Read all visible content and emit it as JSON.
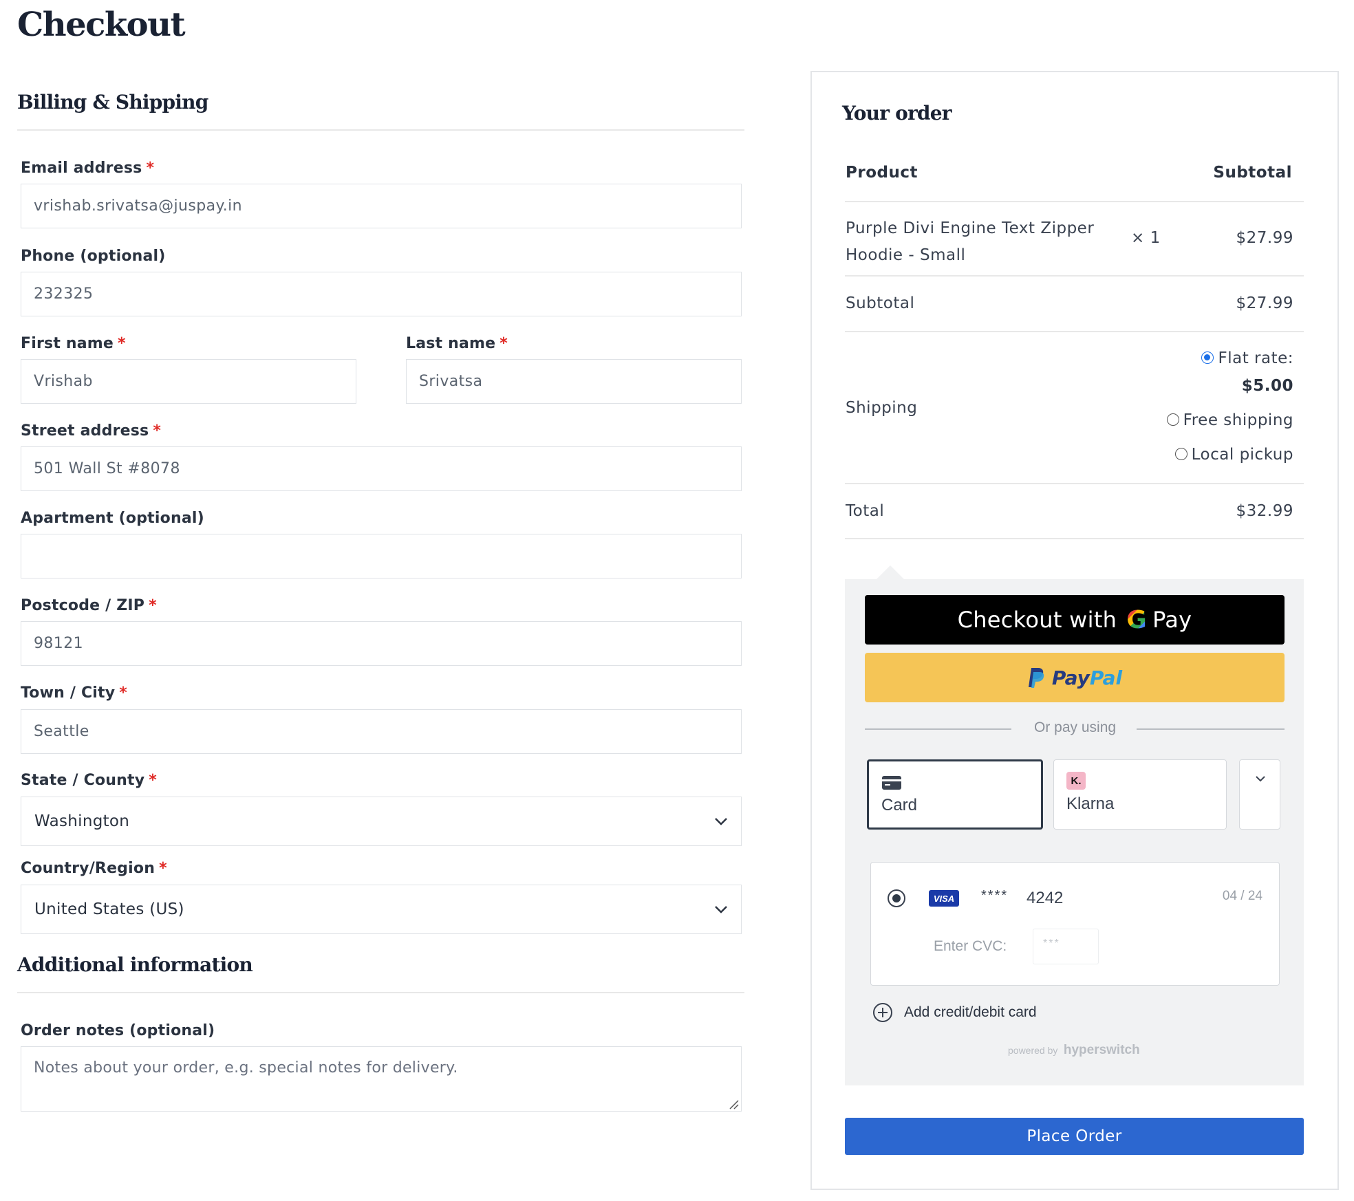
{
  "page": {
    "title": "Checkout"
  },
  "billing": {
    "title": "Billing & Shipping",
    "required_mark": "*",
    "email": {
      "label": "Email address",
      "value": "vrishab.srivatsa@juspay.in"
    },
    "phone": {
      "label": "Phone (optional)",
      "value": "232325"
    },
    "first_name": {
      "label": "First name",
      "value": "Vrishab"
    },
    "last_name": {
      "label": "Last name",
      "value": "Srivatsa"
    },
    "street": {
      "label": "Street address",
      "value": "501 Wall St #8078"
    },
    "apartment": {
      "label": "Apartment (optional)",
      "value": ""
    },
    "postcode": {
      "label": "Postcode / ZIP",
      "value": "98121"
    },
    "city": {
      "label": "Town / City",
      "value": "Seattle"
    },
    "state": {
      "label": "State / County",
      "value": "Washington"
    },
    "country": {
      "label": "Country/Region",
      "value": "United States (US)"
    }
  },
  "additional": {
    "title": "Additional information",
    "notes_label": "Order notes (optional)",
    "notes_placeholder": "Notes about your order, e.g. special notes for delivery."
  },
  "order": {
    "title": "Your order",
    "col_product": "Product",
    "col_subtotal": "Subtotal",
    "item_name_line1": "Purple Divi Engine Text Zipper",
    "item_name_line2": "Hoodie - Small",
    "item_qty": "× 1",
    "item_price": "$27.99",
    "subtotal_label": "Subtotal",
    "subtotal_value": "$27.99",
    "shipping_label": "Shipping",
    "shipping_options": {
      "flat_rate": "Flat rate:",
      "flat_rate_price": "$5.00",
      "free": "Free shipping",
      "pickup": "Local pickup"
    },
    "total_label": "Total",
    "total_value": "$32.99"
  },
  "payment": {
    "gpay_label": "Checkout with",
    "gpay_g": "G",
    "gpay_pay": "Pay",
    "paypal_a": "Pay",
    "paypal_b": "Pal",
    "or_text": "Or pay using",
    "method_card": "Card",
    "method_klarna": "Klarna",
    "klarna_badge": "K.",
    "saved_card": {
      "brand": "VISA",
      "mask": "****",
      "last4": "4242",
      "expiry": "04 / 24",
      "cvc_label": "Enter CVC:",
      "cvc_placeholder": "***"
    },
    "add_card": "Add credit/debit card",
    "powered_by": "powered by",
    "powered_brand": "hyperswitch"
  },
  "actions": {
    "place_order": "Place Order"
  }
}
